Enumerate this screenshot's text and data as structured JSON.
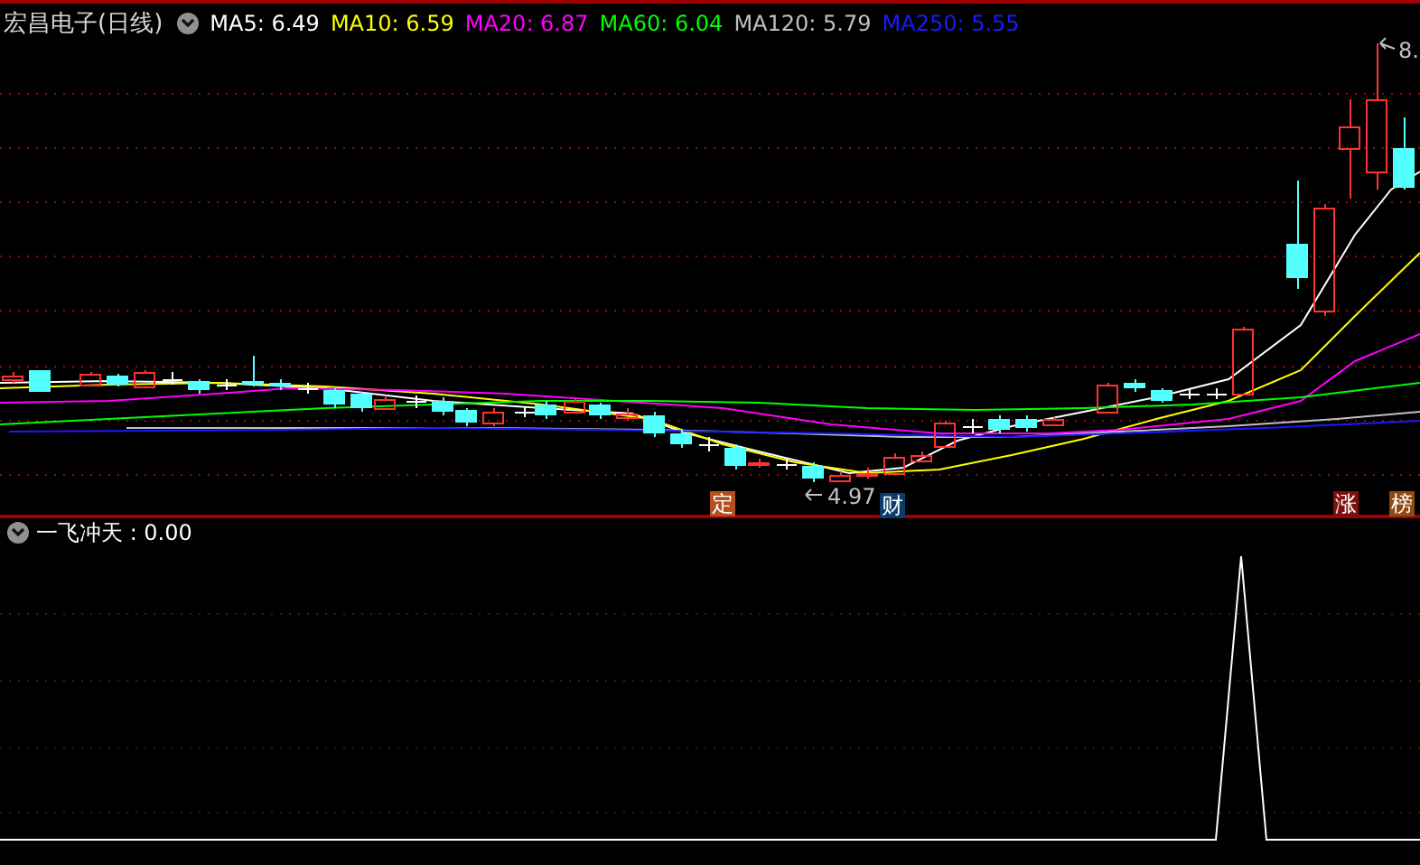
{
  "header": {
    "title": "宏昌电子(日线)",
    "moving_averages": [
      {
        "label": "MA5: 6.49",
        "color": "#ffffff"
      },
      {
        "label": "MA10: 6.59",
        "color": "#ffff00"
      },
      {
        "label": "MA20: 6.87",
        "color": "#ff00ff"
      },
      {
        "label": "MA60: 6.04",
        "color": "#00ff00"
      },
      {
        "label": "MA120: 5.79",
        "color": "#c0c0c0"
      },
      {
        "label": "MA250: 5.55",
        "color": "#1a1aff"
      }
    ]
  },
  "price_chart": {
    "high_label": "8.",
    "low_label": "4.97",
    "markers": [
      {
        "text": "定",
        "color": "#b4501e"
      },
      {
        "text": "财",
        "color": "#0c3c6c"
      },
      {
        "text": "涨",
        "color": "#801010"
      },
      {
        "text": "榜",
        "color": "#8c4a12"
      }
    ]
  },
  "indicator": {
    "label": "一飞冲天 : 0.00"
  }
}
